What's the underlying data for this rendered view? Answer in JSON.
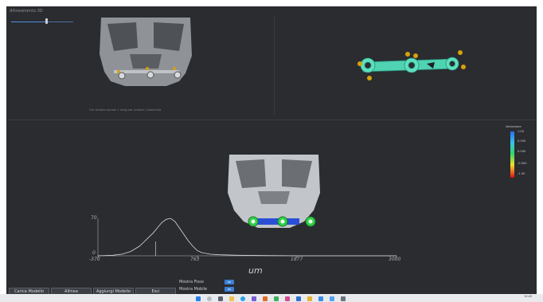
{
  "window": {
    "title": "Allineamento 3D"
  },
  "top_left_view": {
    "caption": "Clic sinistro mouse + drag per ruotare / trascinare"
  },
  "legend": {
    "title": "Variazione",
    "ticks": [
      "1.00",
      "0.500",
      "0.000",
      "-0.500",
      "-1.00"
    ],
    "colors": [
      "#2a6df4",
      "#39c3e6",
      "#32d66a",
      "#f0e02a",
      "#d01010"
    ]
  },
  "histogram": {
    "y_max_label": "70",
    "y_min_label": "0",
    "x_ticks": [
      "-370",
      "763",
      "1877",
      "3000"
    ],
    "unit": "um"
  },
  "buttons": {
    "load": "Carica Modello",
    "align": "Allinea",
    "add": "Aggiungi Modello",
    "exit": "Esci"
  },
  "toggles": {
    "show_fixed": {
      "label": "Mostra Fisso",
      "state": "on"
    },
    "show_mobile": {
      "label": "Mostra Mobile",
      "state": "on"
    }
  },
  "chart_data": {
    "type": "line",
    "title": "",
    "xlabel": "um",
    "ylabel": "",
    "xlim": [
      -370,
      3000
    ],
    "ylim": [
      0,
      70
    ],
    "x": [
      -370,
      -200,
      -100,
      0,
      100,
      150,
      200,
      250,
      300,
      350,
      400,
      450,
      500,
      550,
      600,
      650,
      700,
      750,
      800,
      900,
      1000,
      1200,
      1500,
      2000,
      3000
    ],
    "series": [
      {
        "values": [
          0,
          1,
          3,
          8,
          18,
          26,
          34,
          42,
          52,
          62,
          68,
          70,
          64,
          52,
          40,
          28,
          18,
          10,
          6,
          3,
          2,
          1,
          0.5,
          0,
          0
        ]
      }
    ],
    "marker_x": 280
  },
  "taskbar": {
    "clock": "10:45"
  }
}
